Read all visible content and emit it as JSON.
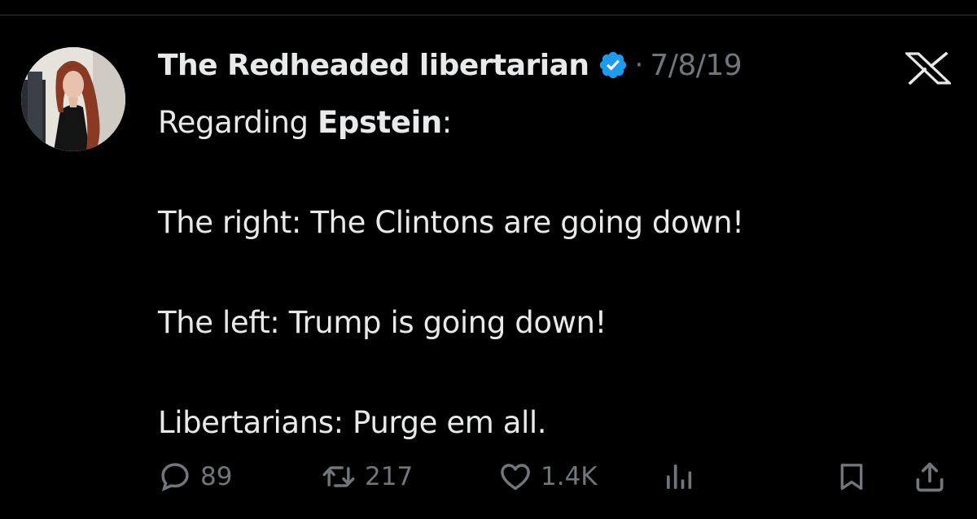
{
  "tweet": {
    "author_name": "The Redheaded libertarian",
    "verified": true,
    "separator": "·",
    "date": "7/8/19",
    "text": {
      "regarding_prefix": "Regarding ",
      "regarding_subject": "Epstein",
      "regarding_suffix": ":",
      "line_right": "The right: The Clintons are going down!",
      "line_left": "The left: Trump is going down!",
      "line_libertarians": "Libertarians: Purge em all."
    }
  },
  "actions": {
    "replies": "89",
    "reposts": "217",
    "likes": "1.4K"
  },
  "icons": {
    "platform": "x-logo-icon",
    "verified": "verified-badge-icon",
    "reply": "reply-icon",
    "repost": "repost-icon",
    "like": "heart-icon",
    "views": "views-chart-icon",
    "bookmark": "bookmark-icon",
    "share": "share-icon"
  },
  "colors": {
    "background": "#000000",
    "text": "#e7e9ea",
    "muted": "#71767b",
    "verified": "#1d9bf0"
  }
}
